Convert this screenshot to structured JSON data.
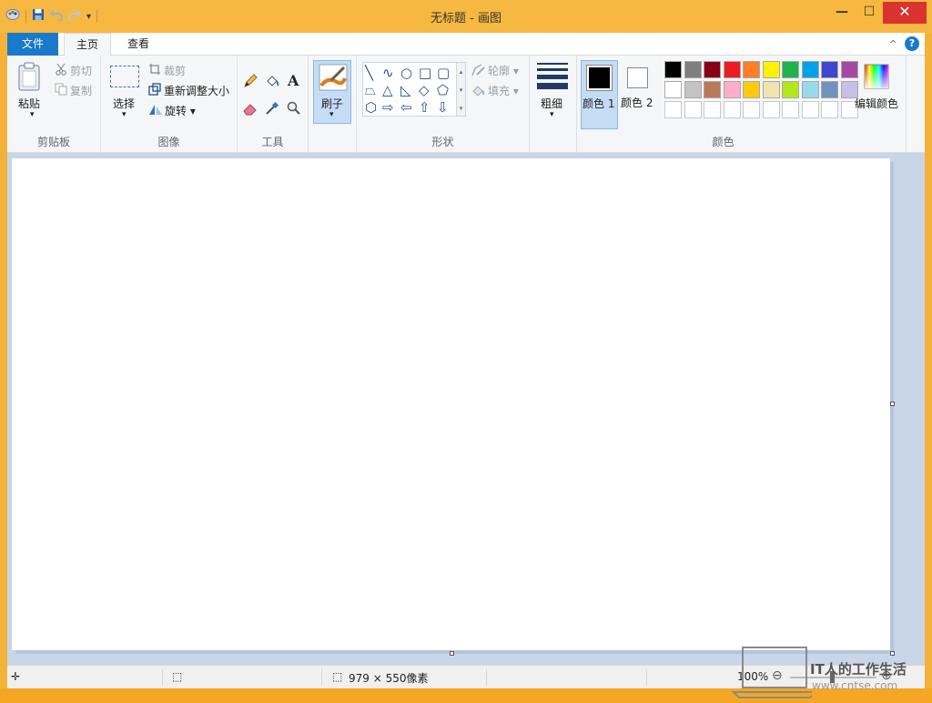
{
  "window": {
    "title": "无标题 - 画图",
    "controls": {
      "minimize": "—",
      "maximize": "☐",
      "close": "✕"
    }
  },
  "qat": {
    "icons": [
      "paint-app-icon",
      "save-icon",
      "undo-icon",
      "redo-icon",
      "customize-arrow-icon"
    ],
    "caret": "▾"
  },
  "tabs": {
    "file": "文件",
    "home": "主页",
    "view": "查看"
  },
  "ribbon_controls": {
    "collapse": "^",
    "help": "?"
  },
  "clipboard": {
    "paste": "粘贴",
    "paste_arrow": "▾",
    "cut": "剪切",
    "copy": "复制",
    "group": "剪贴板"
  },
  "image": {
    "select": "选择",
    "select_arrow": "▾",
    "crop": "裁剪",
    "resize": "重新调整大小",
    "rotate": "旋转 ▾",
    "group": "图像"
  },
  "tools": {
    "text_icon": "A",
    "group": "工具"
  },
  "brushes": {
    "label": "刷子",
    "arrow": "▾"
  },
  "shapes": {
    "gallery": [
      "╲",
      "∿",
      "○",
      "□",
      "▢",
      "⏢",
      "△",
      "◺",
      "◇",
      "⬠",
      "⬡",
      "⇨",
      "⇦",
      "⇧",
      "⇩"
    ],
    "outline": "轮廓 ▾",
    "fill": "填充 ▾",
    "group": "形状"
  },
  "size": {
    "label": "粗细",
    "arrow": "▾"
  },
  "colors": {
    "color1": "颜色 1",
    "color2": "颜色 2",
    "edit": "编辑颜色",
    "group": "颜色",
    "color1_value": "#000000",
    "color2_value": "#ffffff",
    "palette_row1": [
      "#000000",
      "#7f7f7f",
      "#880015",
      "#ed1c24",
      "#ff7f27",
      "#fff200",
      "#22b14c",
      "#00a2e8",
      "#3f48cc",
      "#a349a4"
    ],
    "palette_row2": [
      "#ffffff",
      "#c3c3c3",
      "#b97a57",
      "#ffaec9",
      "#ffc90e",
      "#efe4b0",
      "#b5e61d",
      "#99d9ea",
      "#7092be",
      "#c8bfe7"
    ],
    "palette_row3": [
      "#ffffff",
      "#ffffff",
      "#ffffff",
      "#ffffff",
      "#ffffff",
      "#ffffff",
      "#ffffff",
      "#ffffff",
      "#ffffff",
      "#ffffff"
    ]
  },
  "status": {
    "cursor_icon": "✛",
    "selection_icon": "⬚",
    "size_icon": "⬚",
    "canvas_size": "979 × 550像素",
    "zoom": "100%",
    "zoom_out": "⊖",
    "zoom_in": "⊕"
  },
  "watermark": {
    "title": "IT人的工作生活",
    "url": "www.cntse.com"
  }
}
